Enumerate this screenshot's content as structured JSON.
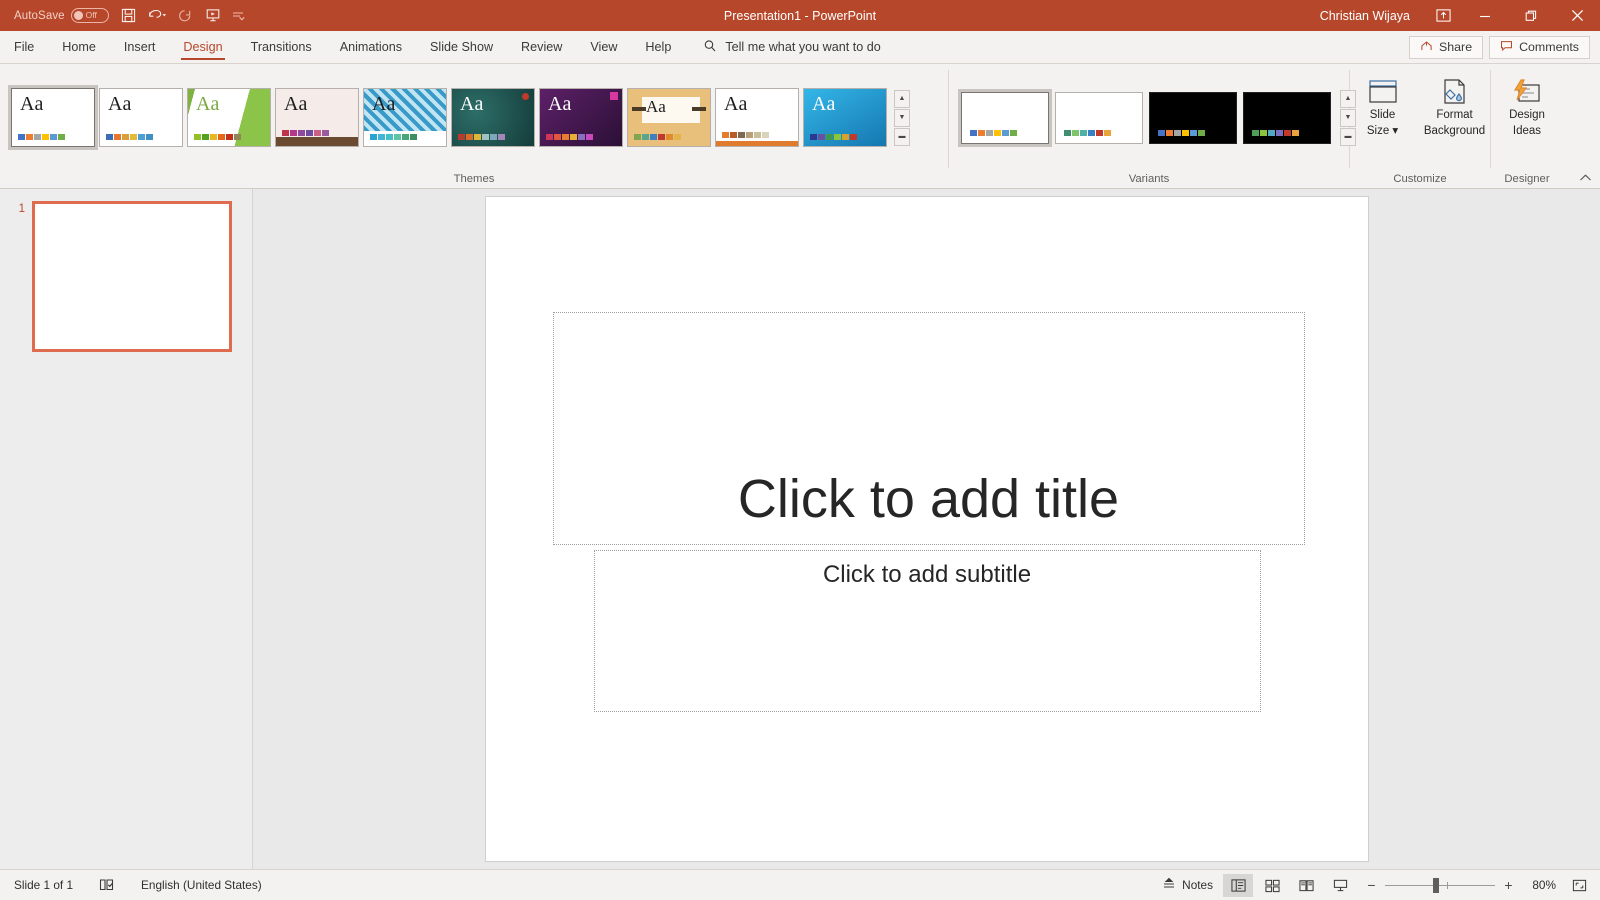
{
  "titlebar": {
    "autosave_label": "AutoSave",
    "autosave_state": "Off",
    "quick_access": [
      {
        "name": "save-button",
        "label": "Save"
      },
      {
        "name": "undo-button",
        "label": "Undo"
      },
      {
        "name": "redo-button",
        "label": "Redo"
      },
      {
        "name": "start-slideshow-button",
        "label": "Start From Beginning"
      },
      {
        "name": "customize-qat-button",
        "label": "Customize Quick Access Toolbar"
      }
    ],
    "document_title": "Presentation1",
    "app_name": "PowerPoint",
    "title_text": "Presentation1  -  PowerPoint",
    "account_name": "Christian Wijaya",
    "ribbon_display_options": "Ribbon Display Options",
    "minimize": "Minimize",
    "restore": "Restore Down",
    "close": "Close",
    "accent_color": "#b7472a"
  },
  "tabs": [
    {
      "label": "File",
      "active": false
    },
    {
      "label": "Home",
      "active": false
    },
    {
      "label": "Insert",
      "active": false
    },
    {
      "label": "Design",
      "active": true
    },
    {
      "label": "Transitions",
      "active": false
    },
    {
      "label": "Animations",
      "active": false
    },
    {
      "label": "Slide Show",
      "active": false
    },
    {
      "label": "Review",
      "active": false
    },
    {
      "label": "View",
      "active": false
    },
    {
      "label": "Help",
      "active": false
    }
  ],
  "tellme": {
    "placeholder": "Tell me what you want to do"
  },
  "tabbar_right": {
    "share_label": "Share",
    "comments_label": "Comments"
  },
  "ribbon": {
    "themes": {
      "group_label": "Themes",
      "items": [
        {
          "name": "theme-office",
          "aa": "Aa",
          "selected": true,
          "bg": "#ffffff",
          "aa_color": "#1d1d1d",
          "swatches": [
            "#4472c4",
            "#ed7d31",
            "#a5a5a5",
            "#ffc000",
            "#5b9bd5",
            "#70ad47"
          ]
        },
        {
          "name": "theme-office-2",
          "aa": "Aa",
          "selected": false,
          "bg": "#ffffff",
          "aa_color": "#1d1d1d",
          "swatches": [
            "#3a6fb8",
            "#e8762c",
            "#d9a03a",
            "#e2b93b",
            "#4b9fd5",
            "#3f8fc4"
          ]
        },
        {
          "name": "theme-facet",
          "aa": "Aa",
          "selected": false,
          "bg": "#ffffff",
          "aa_color": "#7aa940",
          "swatches": [
            "#90c226",
            "#54a021",
            "#e6b91e",
            "#e76618",
            "#c42f1a",
            "#918655"
          ]
        },
        {
          "name": "theme-wisp",
          "aa": "Aa",
          "selected": false,
          "bg": "#f3ece9",
          "aa_color": "#1d1d1d",
          "swatches": [
            "#c0334d",
            "#b5368a",
            "#8e4b9e",
            "#6f4c9f",
            "#cc5f86",
            "#9a5aa0"
          ]
        },
        {
          "name": "theme-crop",
          "aa": "Aa",
          "selected": false,
          "bg": "#2f8fc2",
          "aa_color": "#1d1d1d",
          "swatches": [
            "#29a3cf",
            "#43b6d6",
            "#45c0c8",
            "#5fc3a8",
            "#48a678",
            "#3c8f62"
          ]
        },
        {
          "name": "theme-ion-boardroom",
          "aa": "Aa",
          "selected": false,
          "bg": "#1f4e4a",
          "aa_color": "#ffffff",
          "swatches": [
            "#b83c2e",
            "#d86a2c",
            "#e0b63a",
            "#9ec3c0",
            "#7da8b8",
            "#a486bb"
          ]
        },
        {
          "name": "theme-berlin",
          "aa": "Aa",
          "selected": false,
          "bg": "#4b1c56",
          "aa_color": "#ffffff",
          "swatches": [
            "#d0345a",
            "#e2563f",
            "#e87d2f",
            "#e8b135",
            "#8a6ec0",
            "#c849b9"
          ]
        },
        {
          "name": "theme-badge",
          "aa": "Aa",
          "selected": false,
          "bg": "#e9bf7c",
          "aa_color": "#1d1d1d",
          "swatches": [
            "#7fa653",
            "#58a68b",
            "#3f7fc1",
            "#c0392b",
            "#e08a2e",
            "#e2b44a"
          ]
        },
        {
          "name": "theme-banded",
          "aa": "Aa",
          "selected": false,
          "bg": "#ffffff",
          "aa_color": "#1d1d1d",
          "swatches": [
            "#e57b2c",
            "#b85a2a",
            "#7c6a55",
            "#b8a07a",
            "#cbbf9a",
            "#d9d2bc"
          ]
        },
        {
          "name": "theme-celestial",
          "aa": "Aa",
          "selected": false,
          "bg": "#1f9ed4",
          "aa_color": "#ffffff",
          "swatches": [
            "#2b3a8f",
            "#6a4fa3",
            "#3f9a4e",
            "#8cc43c",
            "#d9a22e",
            "#c0392b"
          ]
        }
      ],
      "scroll_up": "Scroll Up",
      "scroll_down": "Scroll Down",
      "more": "More"
    },
    "variants": {
      "group_label": "Variants",
      "items": [
        {
          "name": "variant-1",
          "selected": true,
          "dark": false,
          "swatches": [
            "#4472c4",
            "#ed7d31",
            "#a5a5a5",
            "#ffc000",
            "#5b9bd5",
            "#70ad47"
          ]
        },
        {
          "name": "variant-2",
          "selected": false,
          "dark": false,
          "swatches": [
            "#3f8f6e",
            "#7ec46a",
            "#4fb0a8",
            "#3a7fc4",
            "#c0392b",
            "#e8a33d"
          ]
        },
        {
          "name": "variant-3",
          "selected": false,
          "dark": true,
          "swatches": [
            "#4472c4",
            "#ed7d31",
            "#a5a5a5",
            "#ffc000",
            "#5b9bd5",
            "#70ad47"
          ]
        },
        {
          "name": "variant-4",
          "selected": false,
          "dark": true,
          "swatches": [
            "#4f9e5a",
            "#8cc43c",
            "#4fa8c4",
            "#7a6fc0",
            "#c0392b",
            "#e8a33d"
          ]
        }
      ],
      "scroll_up": "Scroll Up",
      "scroll_down": "Scroll Down",
      "more": "More"
    },
    "customize": {
      "group_label": "Customize",
      "slide_size_line1": "Slide",
      "slide_size_line2": "Size",
      "format_background_line1": "Format",
      "format_background_line2": "Background"
    },
    "designer": {
      "group_label": "Designer",
      "design_ideas_line1": "Design",
      "design_ideas_line2": "Ideas"
    },
    "collapse_label": "Collapse the Ribbon"
  },
  "thumbnail_pane": {
    "slides": [
      {
        "number": "1",
        "selected": true
      }
    ]
  },
  "slide": {
    "title_placeholder": "Click to add title",
    "subtitle_placeholder": "Click to add subtitle"
  },
  "statusbar": {
    "slide_count_text": "Slide 1 of 1",
    "spellcheck_label": "Spelling and Grammar Check",
    "language": "English (United States)",
    "notes_label": "Notes",
    "views": [
      {
        "name": "normal-view-button",
        "label": "Normal",
        "active": true
      },
      {
        "name": "slide-sorter-view-button",
        "label": "Slide Sorter",
        "active": false
      },
      {
        "name": "reading-view-button",
        "label": "Reading View",
        "active": false
      },
      {
        "name": "slideshow-view-button",
        "label": "Slide Show",
        "active": false
      }
    ],
    "zoom_out": "−",
    "zoom_in": "+",
    "zoom_level": "80%",
    "fit_label": "Fit slide to current window"
  }
}
